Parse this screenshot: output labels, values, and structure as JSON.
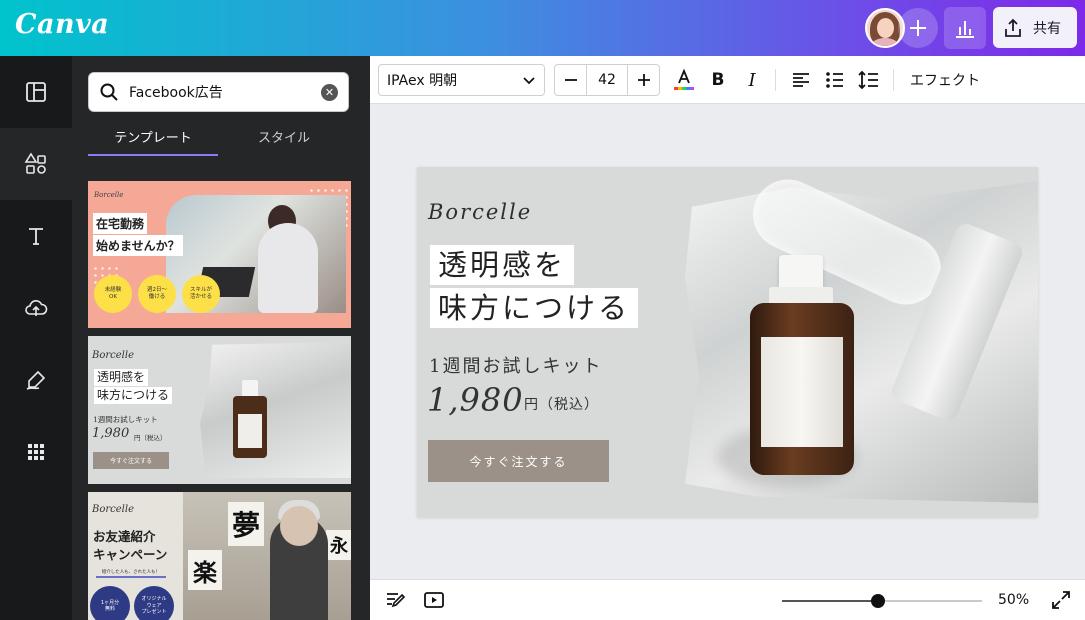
{
  "header": {
    "logo": "Canva",
    "share_label": "共有"
  },
  "sidebar": {
    "rail_icons": [
      "layout-icon",
      "elements-icon",
      "text-icon",
      "upload-icon",
      "draw-icon",
      "apps-icon"
    ],
    "search": {
      "value": "Facebook広告"
    },
    "tabs": [
      {
        "label": "テンプレート",
        "active": true
      },
      {
        "label": "スタイル",
        "active": false
      }
    ],
    "templates": [
      {
        "brand": "Borcelle",
        "line1": "在宅勤務",
        "line2": "始めませんか？",
        "badges": [
          "未経験\nOK",
          "週2日〜\n働ける",
          "スキルが\n活かせる"
        ]
      },
      {
        "brand": "Borcelle",
        "line1": "透明感を",
        "line2": "味方につける",
        "kit": "1週間お試しキット",
        "price": "1,980",
        "yen": "円（税込）",
        "cta": "今すぐ注文する"
      },
      {
        "brand": "Borcelle",
        "line1": "お友達紹介",
        "line2": "キャンペーン",
        "sub": "紹介した人も、された人も！",
        "badges": [
          "1ヶ月分\n無料",
          "オリジナル\nウェア\nプレゼント"
        ],
        "calligraphy": [
          "夢",
          "楽",
          "永"
        ]
      }
    ]
  },
  "toolbar": {
    "font": "IPAex 明朝",
    "font_size": "42",
    "effect_label": "エフェクト"
  },
  "design": {
    "brand": "Borcelle",
    "headline1": "透明感を",
    "headline2": "味方につける",
    "kit": "1週間お試しキット",
    "price": "1,980",
    "yen": "円（税込）",
    "cta": "今すぐ注文する"
  },
  "footer": {
    "zoom_label": "50%",
    "zoom_level": 0.5
  },
  "colors": {
    "accent": "#7d2ae8",
    "cta": "#9b9188",
    "panel": "#252627"
  }
}
